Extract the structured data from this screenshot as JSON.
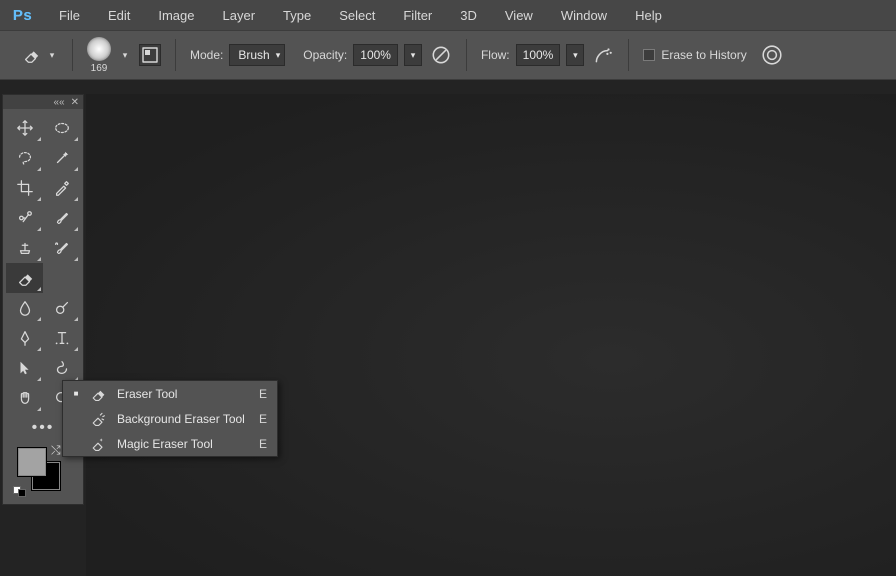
{
  "app": {
    "logo": "Ps"
  },
  "menu": [
    "File",
    "Edit",
    "Image",
    "Layer",
    "Type",
    "Select",
    "Filter",
    "3D",
    "View",
    "Window",
    "Help"
  ],
  "optbar": {
    "brush_size": "169",
    "mode_label": "Mode:",
    "mode_value": "Brush",
    "opacity_label": "Opacity:",
    "opacity_value": "100%",
    "flow_label": "Flow:",
    "flow_value": "100%",
    "erase_history_label": "Erase to History"
  },
  "flyout": {
    "items": [
      {
        "label": "Eraser Tool",
        "key": "E",
        "active": true,
        "icon": "eraser-icon"
      },
      {
        "label": "Background Eraser Tool",
        "key": "E",
        "active": false,
        "icon": "bg-eraser-icon"
      },
      {
        "label": "Magic Eraser Tool",
        "key": "E",
        "active": false,
        "icon": "magic-eraser-icon"
      }
    ]
  }
}
